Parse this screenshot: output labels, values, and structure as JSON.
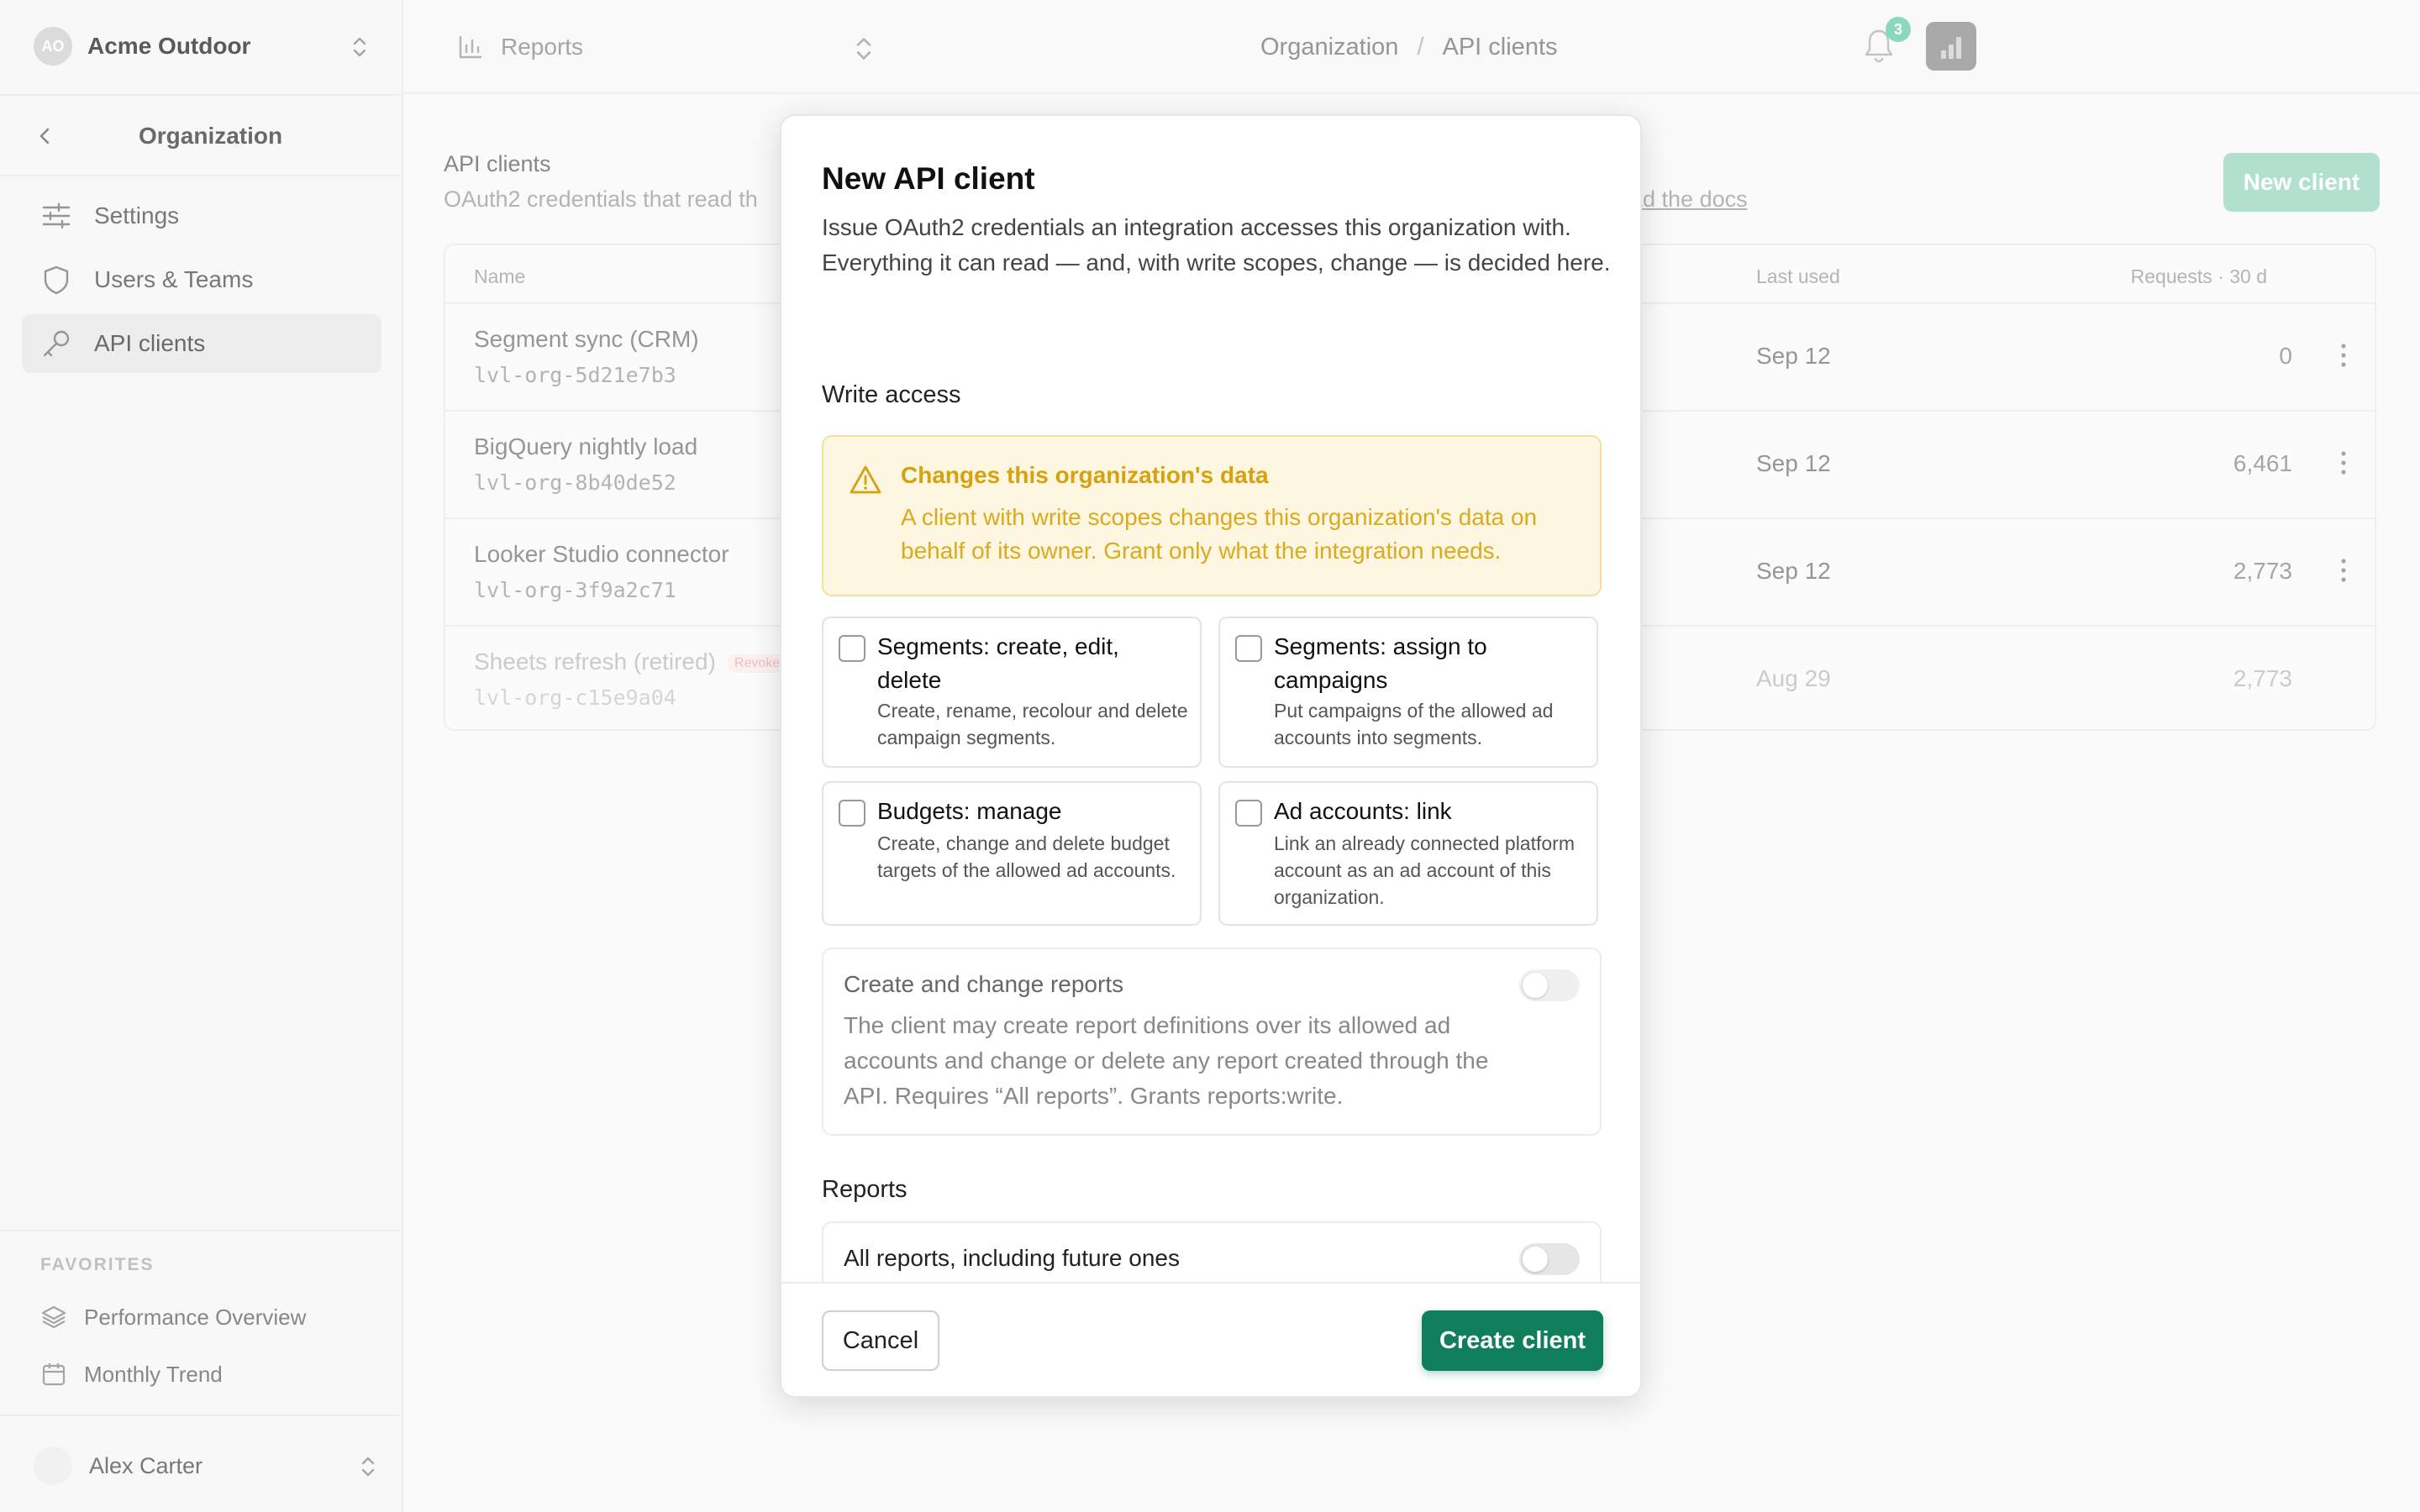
{
  "sidebar": {
    "org_initials": "AO",
    "org_name": "Acme Outdoor",
    "section_title": "Organization",
    "items": [
      {
        "label": "Settings",
        "icon": "sliders-icon"
      },
      {
        "label": "Users & Teams",
        "icon": "shield-icon"
      },
      {
        "label": "API clients",
        "icon": "key-icon",
        "active": true
      }
    ],
    "favorites_label": "FAVORITES",
    "favorites": [
      {
        "label": "Performance Overview",
        "icon": "layers-icon"
      },
      {
        "label": "Monthly Trend",
        "icon": "calendar-icon"
      }
    ],
    "user_name": "Alex Carter"
  },
  "topbar": {
    "report_switch": "Reports",
    "breadcrumb": [
      "Organization",
      "API clients"
    ],
    "breadcrumb_sep": "/",
    "notification_count": "3"
  },
  "page": {
    "title": "API clients",
    "subtitle": "OAuth2 credentials that read th",
    "docs_link": "ad the docs",
    "new_client_label": "New client",
    "columns": {
      "name": "Name",
      "last_used": "Last used",
      "requests": "Requests · 30 d"
    },
    "rows": [
      {
        "name": "Segment sync (CRM)",
        "id": "lvl-org-5d21e7b3",
        "last_used": "Sep 12",
        "requests": "0"
      },
      {
        "name": "BigQuery nightly load",
        "id": "lvl-org-8b40de52",
        "last_used": "Sep 12",
        "requests": "6,461"
      },
      {
        "name": "Looker Studio connector",
        "id": "lvl-org-3f9a2c71",
        "last_used": "Sep 12",
        "requests": "2,773"
      },
      {
        "name": "Sheets refresh (retired)",
        "badge": "Revoked",
        "id": "lvl-org-c15e9a04",
        "last_used": "Aug 29",
        "requests": "2,773"
      }
    ]
  },
  "modal": {
    "title": "New API client",
    "description": "Issue OAuth2 credentials an integration accesses this organization with. Everything it can read — and, with write scopes, change — is decided here.",
    "write_access_heading": "Write access",
    "warning": {
      "title": "Changes this organization's data",
      "body": "A client with write scopes changes this organization's data on behalf of its owner. Grant only what the integration needs."
    },
    "permissions": [
      {
        "title": "Segments: create, edit, delete",
        "desc": "Create, rename, recolour and delete campaign segments.",
        "checked": false
      },
      {
        "title": "Segments: assign to campaigns",
        "desc": "Put campaigns of the allowed ad accounts into segments.",
        "checked": false
      },
      {
        "title": "Budgets: manage",
        "desc": "Create, change and delete budget targets of the allowed ad accounts.",
        "checked": false
      },
      {
        "title": "Ad accounts: link",
        "desc": "Link an already connected platform account as an ad account of this organization.",
        "checked": false
      }
    ],
    "reports_write": {
      "title": "Create and change reports",
      "desc": "The client may create report definitions over its allowed ad accounts and change or delete any report created through the API. Requires “All reports”. Grants reports:write.",
      "enabled": false
    },
    "reports_heading": "Reports",
    "all_reports": {
      "title": "All reports, including future ones",
      "enabled": false
    },
    "cancel_label": "Cancel",
    "create_label": "Create client"
  },
  "colors": {
    "primary": "#0f7f5b",
    "warning_bg": "#fdf6e0",
    "warning_text": "#d8a20e",
    "badge": "#7bd4b4"
  }
}
